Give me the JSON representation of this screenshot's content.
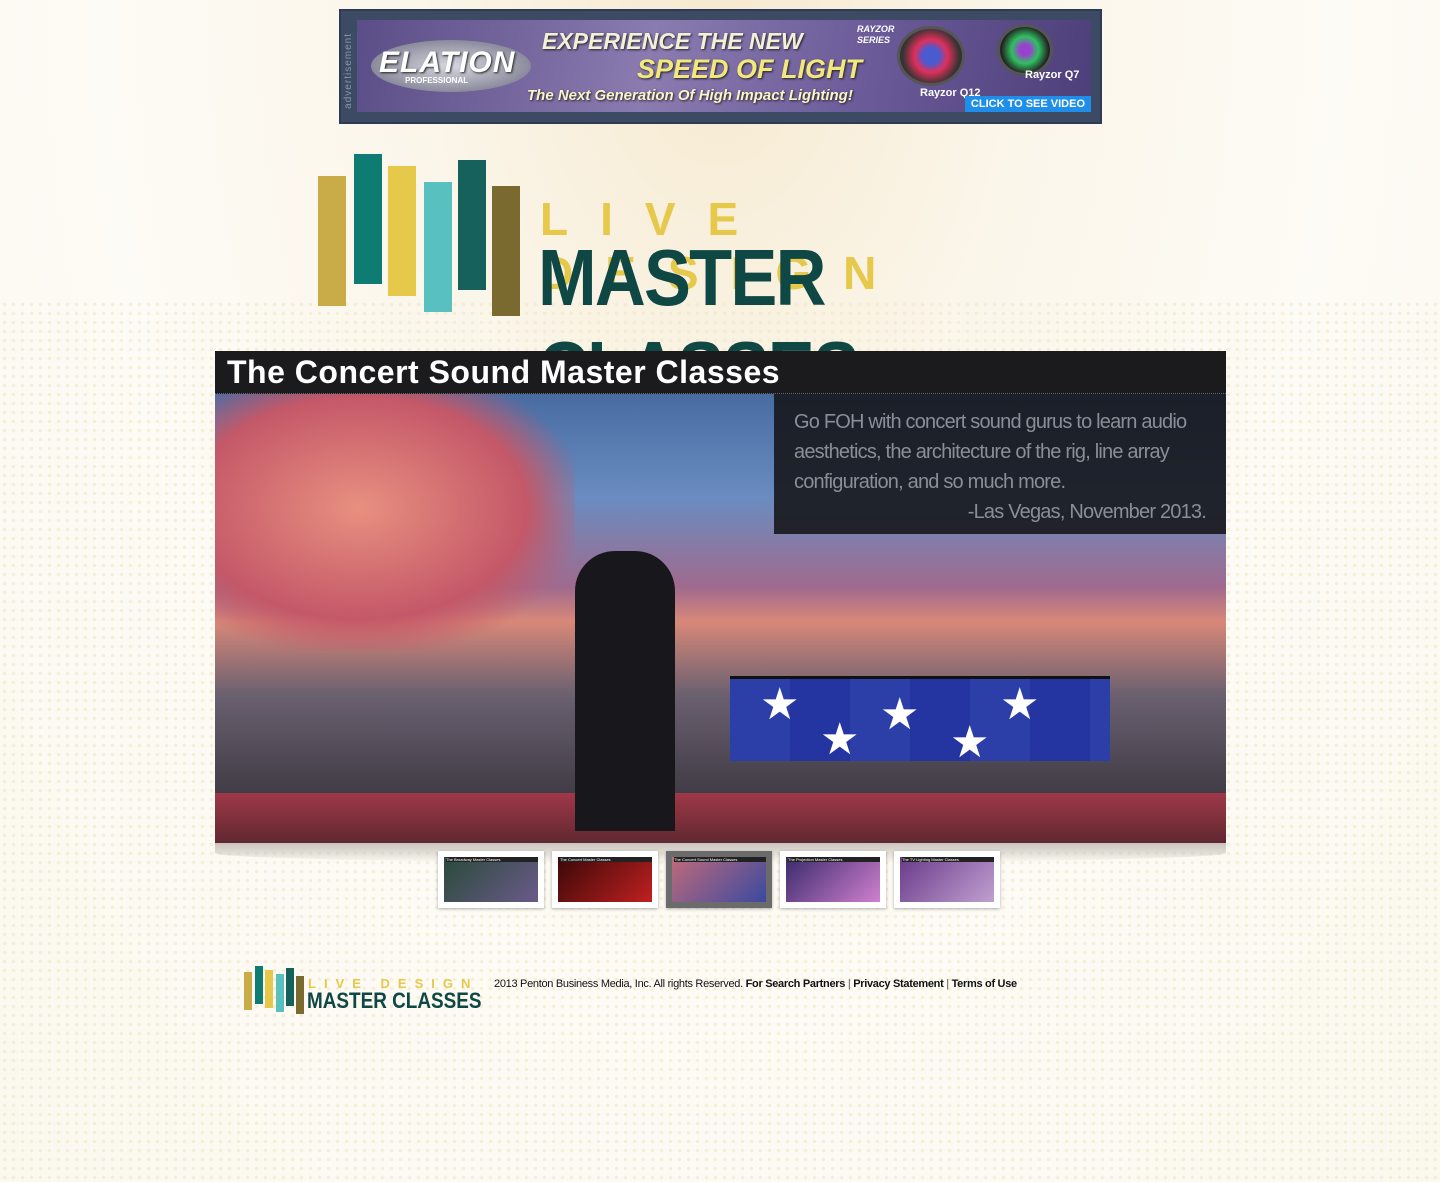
{
  "ad": {
    "label": "advertisement",
    "brand": "ELATION",
    "brand_sub": "PROFESSIONAL",
    "line1": "EXPERIENCE THE NEW",
    "line2": "SPEED OF LIGHT",
    "line3": "The Next Generation Of High Impact Lighting!",
    "series": "RAYZOR SERIES",
    "product1": "Rayzor Q12",
    "product2": "Rayzor Q7",
    "cta": "CLICK TO SEE VIDEO"
  },
  "logo": {
    "line1": "LIVE DESIGN",
    "line2": "MASTER CLASSES",
    "colors": [
      "#c9ac48",
      "#0e7c72",
      "#e6c84a",
      "#58c0bf",
      "#17615c",
      "#7a6a30"
    ]
  },
  "hero": {
    "title": "The Concert Sound Master Classes",
    "description": "Go FOH with concert sound gurus to learn audio aesthetics, the architecture of the rig, line array configuration, and so much more.",
    "signature": "-Las Vegas, November 2013."
  },
  "thumbnails": [
    {
      "caption": "The Broadway Master Classes",
      "colors": [
        "#2a4a3a",
        "#6a5a8a"
      ]
    },
    {
      "caption": "The Concert Master Classes",
      "colors": [
        "#3a0808",
        "#c02020"
      ]
    },
    {
      "caption": "The Concert Sound Master Classes",
      "colors": [
        "#c06a7a",
        "#3a4aa0"
      ],
      "active": true
    },
    {
      "caption": "The Projection Master Classes",
      "colors": [
        "#3a2a6a",
        "#d080d0"
      ]
    },
    {
      "caption": "The TV Lighting Master Classes",
      "colors": [
        "#6a3a8a",
        "#c0a0d0"
      ]
    }
  ],
  "footer": {
    "logo_line1": "LIVE DESIGN",
    "logo_line2": "MASTER CLASSES",
    "copyright": "2013 Penton Business Media, Inc. All rights Reserved.",
    "links": [
      "For Search Partners",
      "Privacy Statement",
      "Terms of Use"
    ]
  }
}
